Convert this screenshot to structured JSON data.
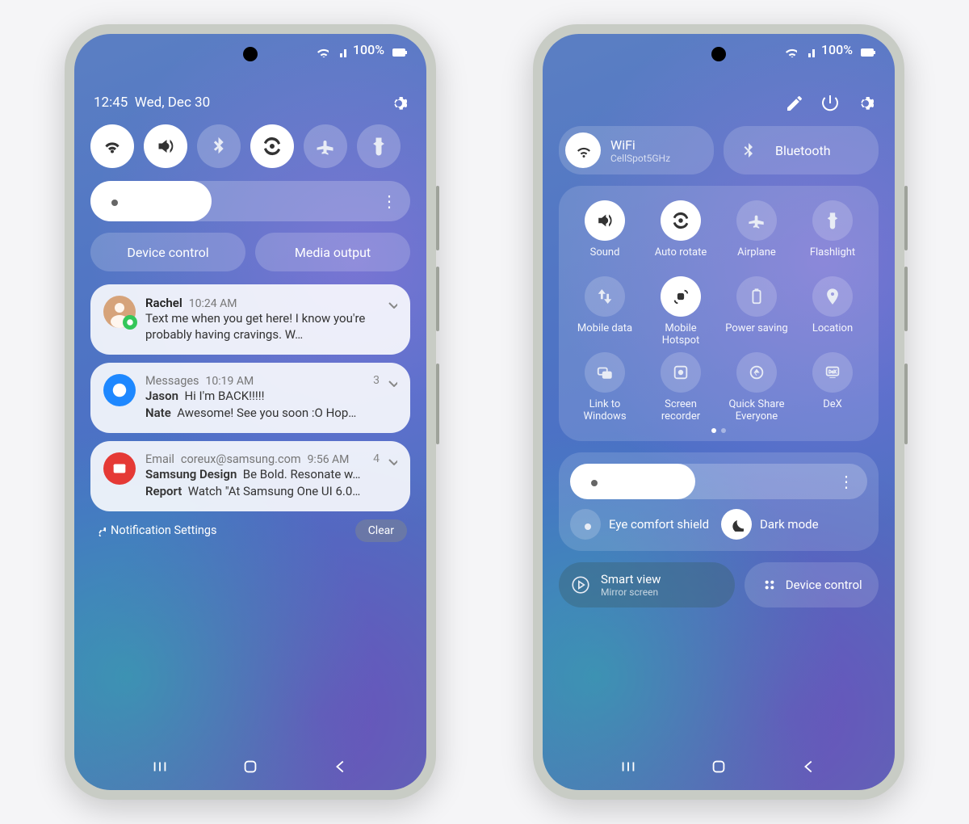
{
  "status": {
    "battery_text": "100%"
  },
  "shade": {
    "time": "12:45",
    "date": "Wed, Dec 30",
    "quick_tiles": [
      {
        "name": "wifi",
        "on": true
      },
      {
        "name": "sound",
        "on": true
      },
      {
        "name": "bluetooth",
        "on": false
      },
      {
        "name": "autorotate",
        "on": true
      },
      {
        "name": "airplane",
        "on": false
      },
      {
        "name": "flashlight",
        "on": false
      }
    ],
    "brightness_pct": 38,
    "device_control_label": "Device control",
    "media_output_label": "Media output",
    "notification_settings_label": "Notification Settings",
    "clear_label": "Clear"
  },
  "notifications": [
    {
      "sender": "Rachel",
      "time": "10:24 AM",
      "preview": "Text me when you get here! I know you're probably having cravings. W…",
      "avatar_color": "#d6a37a",
      "badge_color": "#34c759"
    },
    {
      "app": "Messages",
      "time": "10:19 AM",
      "count": "3",
      "icon_bg": "#1e88ff",
      "rows": [
        {
          "who": "Jason",
          "text": "Hi I'm BACK!!!!!"
        },
        {
          "who": "Nate",
          "text": "Awesome! See you soon :O Hop…"
        }
      ]
    },
    {
      "app": "Email",
      "account": "coreux@samsung.com",
      "time": "9:56 AM",
      "count": "4",
      "icon_bg": "#e53935",
      "rows": [
        {
          "who": "Samsung Design",
          "text": "Be Bold. Resonate w…"
        },
        {
          "who": "Report",
          "text": "Watch \"At Samsung One UI 6.0…"
        }
      ]
    }
  ],
  "panel": {
    "wifi_label": "WiFi",
    "wifi_sub": "CellSpot5GHz",
    "bt_label": "Bluetooth",
    "grid": [
      {
        "name": "Sound",
        "icon": "sound",
        "on": true
      },
      {
        "name": "Auto rotate",
        "icon": "autorotate",
        "on": true
      },
      {
        "name": "Airplane",
        "icon": "airplane",
        "on": false
      },
      {
        "name": "Flashlight",
        "icon": "flashlight",
        "on": false
      },
      {
        "name": "Mobile data",
        "icon": "mobiledata",
        "on": false
      },
      {
        "name": "Mobile Hotspot",
        "icon": "hotspot",
        "on": true
      },
      {
        "name": "Power saving",
        "icon": "powersave",
        "on": false
      },
      {
        "name": "Location",
        "icon": "location",
        "on": false
      },
      {
        "name": "Link to Windows",
        "icon": "link",
        "on": false
      },
      {
        "name": "Screen recorder",
        "icon": "record",
        "on": false
      },
      {
        "name": "Quick Share Everyone",
        "icon": "quickshare",
        "on": false
      },
      {
        "name": "DeX",
        "icon": "dex",
        "on": false
      }
    ],
    "brightness_pct": 42,
    "eye_label": "Eye comfort shield",
    "dark_label": "Dark mode",
    "smart_label": "Smart view",
    "smart_sub": "Mirror screen",
    "device_control_label": "Device control"
  }
}
